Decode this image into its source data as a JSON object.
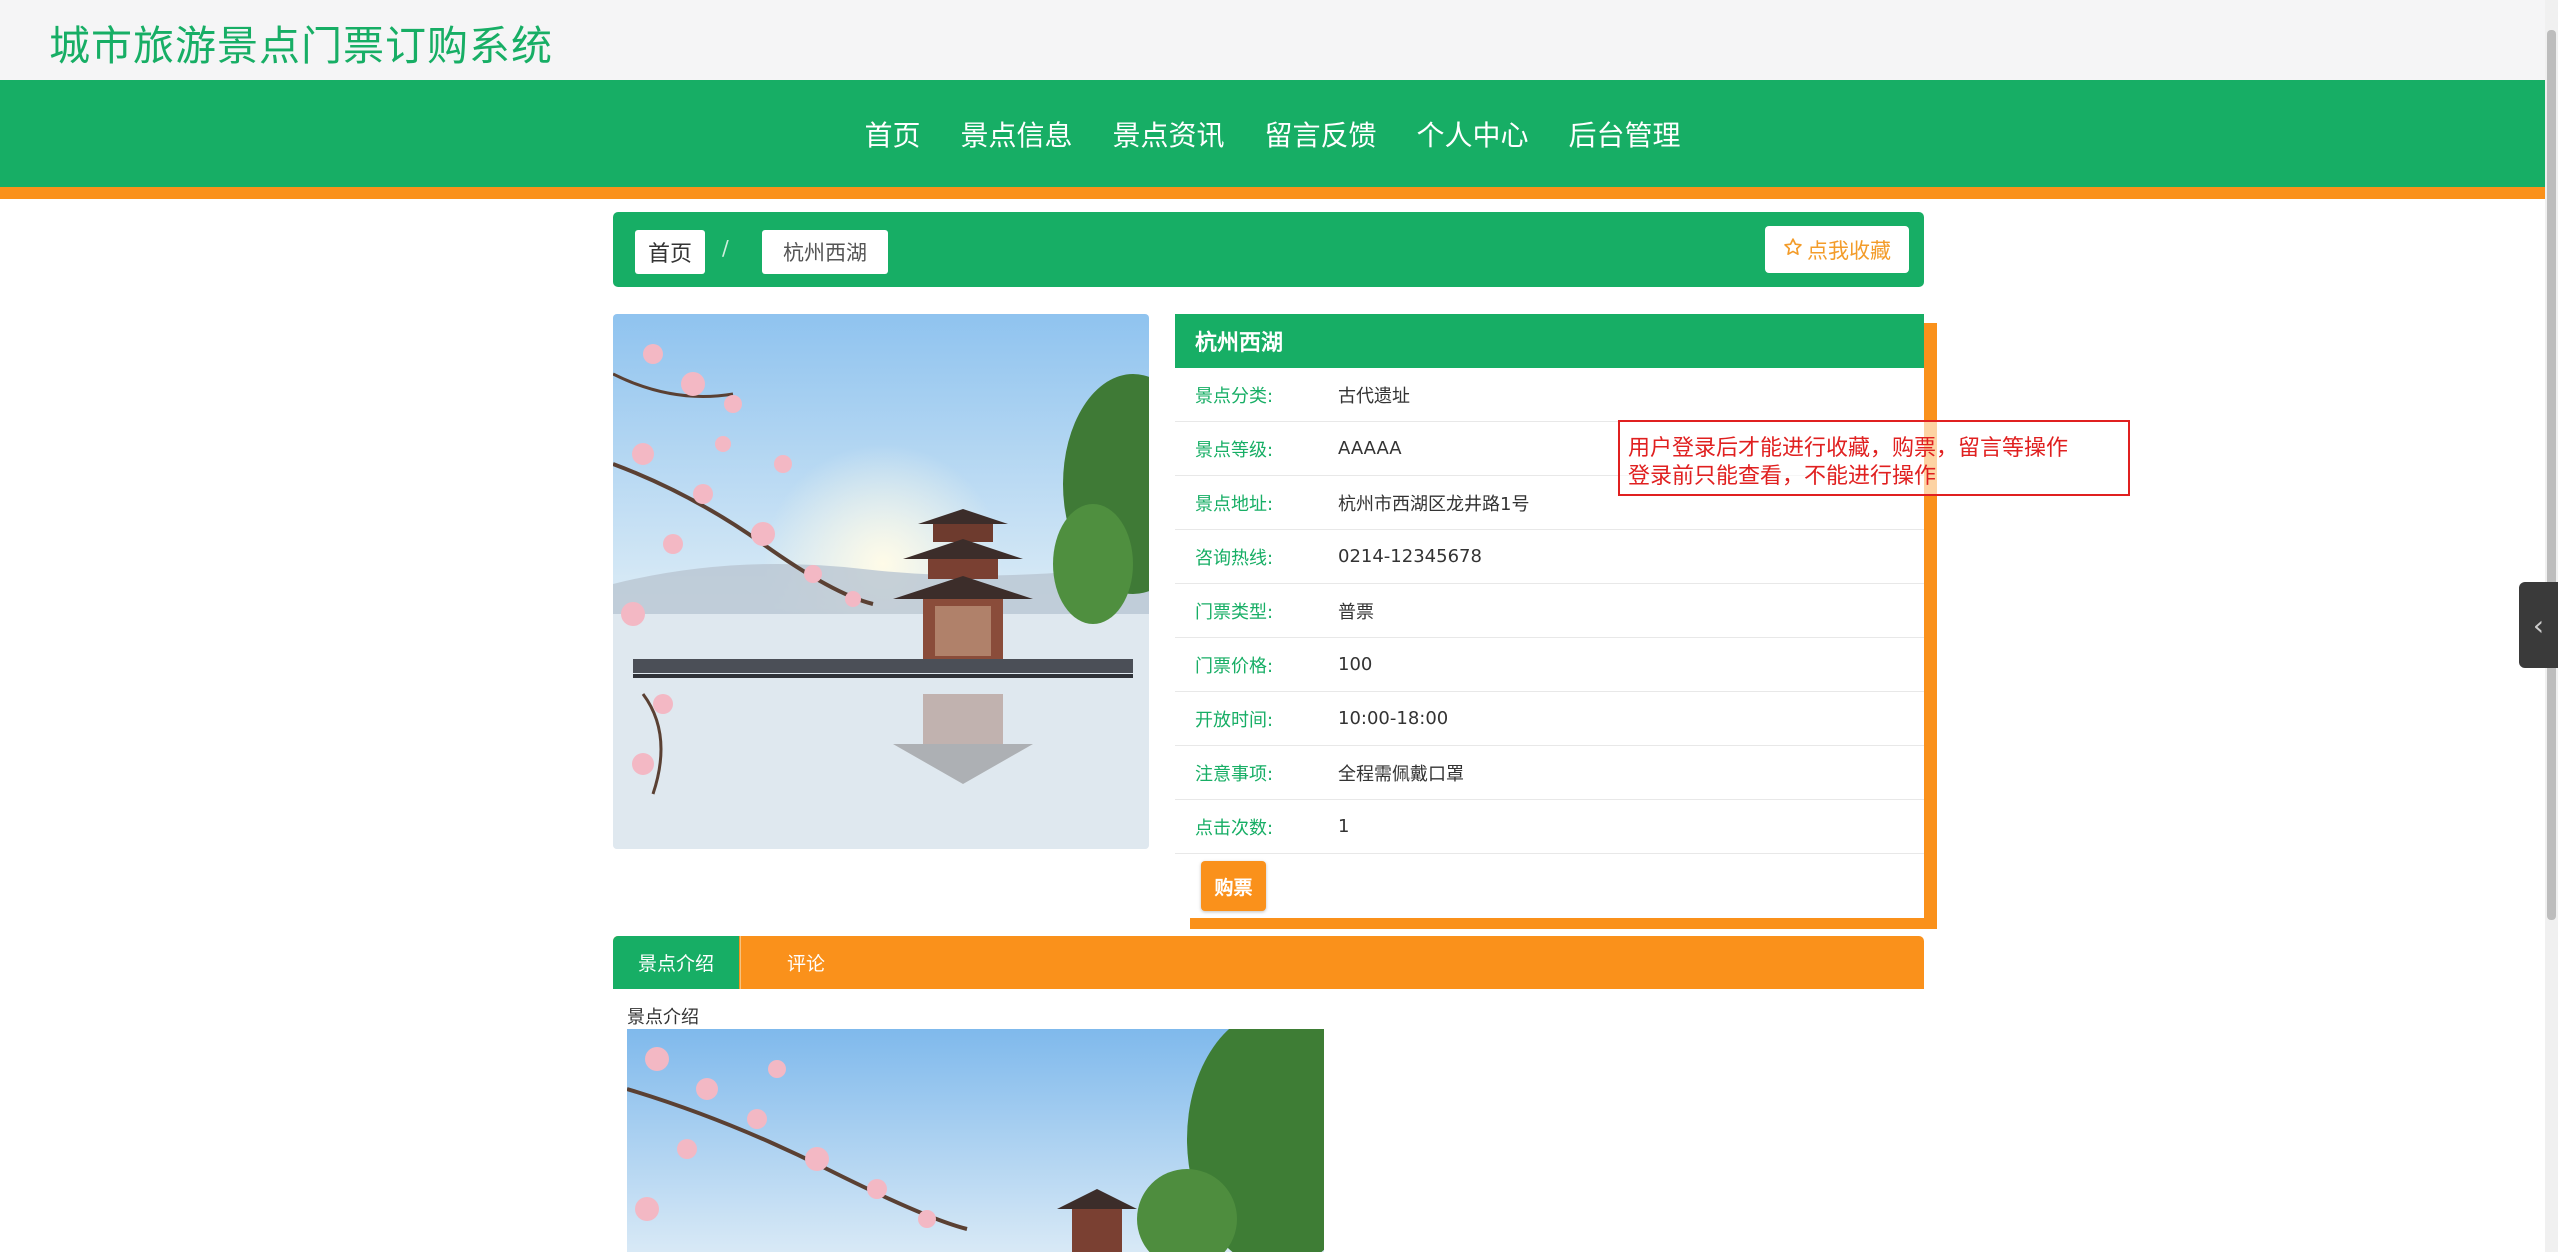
{
  "site": {
    "title": "城市旅游景点门票订购系统"
  },
  "nav": {
    "items": [
      {
        "label": "首页"
      },
      {
        "label": "景点信息"
      },
      {
        "label": "景点资讯"
      },
      {
        "label": "留言反馈"
      },
      {
        "label": "个人中心"
      },
      {
        "label": "后台管理"
      }
    ]
  },
  "breadcrumb": {
    "home": "首页",
    "separator": "/",
    "current": "杭州西湖"
  },
  "favorite": {
    "icon": "star-outline-icon",
    "label": "点我收藏"
  },
  "detail": {
    "name": "杭州西湖",
    "rows": [
      {
        "label": "景点分类:",
        "value": "古代遗址"
      },
      {
        "label": "景点等级:",
        "value": "AAAAA"
      },
      {
        "label": "景点地址:",
        "value": "杭州市西湖区龙井路1号"
      },
      {
        "label": "咨询热线:",
        "value": "0214-12345678"
      },
      {
        "label": "门票类型:",
        "value": "普票"
      },
      {
        "label": "门票价格:",
        "value": "100"
      },
      {
        "label": "开放时间:",
        "value": "10:00-18:00"
      },
      {
        "label": "注意事项:",
        "value": "全程需佩戴口罩"
      },
      {
        "label": "点击次数:",
        "value": "1"
      }
    ],
    "buy_label": "购票"
  },
  "annotation": {
    "line1": "用户登录后才能进行收藏，购票，留言等操作",
    "line2": "登录前只能查看，不能进行操作"
  },
  "tabs": [
    {
      "label": "景点介绍"
    },
    {
      "label": "评论"
    }
  ],
  "intro": {
    "label": "景点介绍"
  },
  "colors": {
    "primary": "#17ae65",
    "accent": "#fa911b",
    "annotation": "#e02020"
  },
  "side_toggle": {
    "icon": "chevron-left-icon"
  }
}
